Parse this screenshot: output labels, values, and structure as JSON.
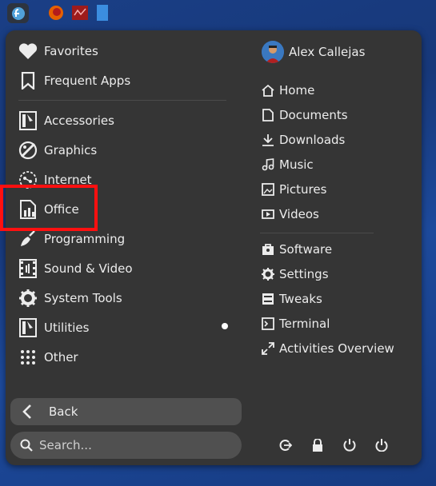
{
  "categories": [
    {
      "label": "Favorites",
      "icon": "heart-icon"
    },
    {
      "label": "Frequent Apps",
      "icon": "bookmark-icon"
    },
    {
      "label": "Accessories",
      "icon": "accessories-icon"
    },
    {
      "label": "Graphics",
      "icon": "graphics-icon"
    },
    {
      "label": "Internet",
      "icon": "globe-icon"
    },
    {
      "label": "Office",
      "icon": "office-document-icon"
    },
    {
      "label": "Programming",
      "icon": "programming-icon"
    },
    {
      "label": "Sound & Video",
      "icon": "film-icon"
    },
    {
      "label": "System Tools",
      "icon": "gear-icon"
    },
    {
      "label": "Utilities",
      "icon": "utilities-icon"
    },
    {
      "label": "Other",
      "icon": "grid-dots-icon"
    }
  ],
  "user": {
    "name": "Alex Callejas"
  },
  "places": [
    {
      "label": "Home",
      "icon": "home-icon"
    },
    {
      "label": "Documents",
      "icon": "document-icon"
    },
    {
      "label": "Downloads",
      "icon": "download-icon"
    },
    {
      "label": "Music",
      "icon": "music-icon"
    },
    {
      "label": "Pictures",
      "icon": "picture-icon"
    },
    {
      "label": "Videos",
      "icon": "video-icon"
    }
  ],
  "shortcuts": [
    {
      "label": "Software",
      "icon": "software-icon"
    },
    {
      "label": "Settings",
      "icon": "settings-icon"
    },
    {
      "label": "Tweaks",
      "icon": "tweaks-icon"
    },
    {
      "label": "Terminal",
      "icon": "terminal-icon"
    },
    {
      "label": "Activities Overview",
      "icon": "expand-icon"
    }
  ],
  "back": {
    "label": "Back"
  },
  "search": {
    "placeholder": "Search..."
  },
  "system": [
    "logout-icon",
    "lock-icon",
    "restart-icon",
    "power-icon"
  ],
  "colors": {
    "panel": "#353535",
    "highlight": "#ff1010",
    "desktop": "#1a3f86"
  }
}
